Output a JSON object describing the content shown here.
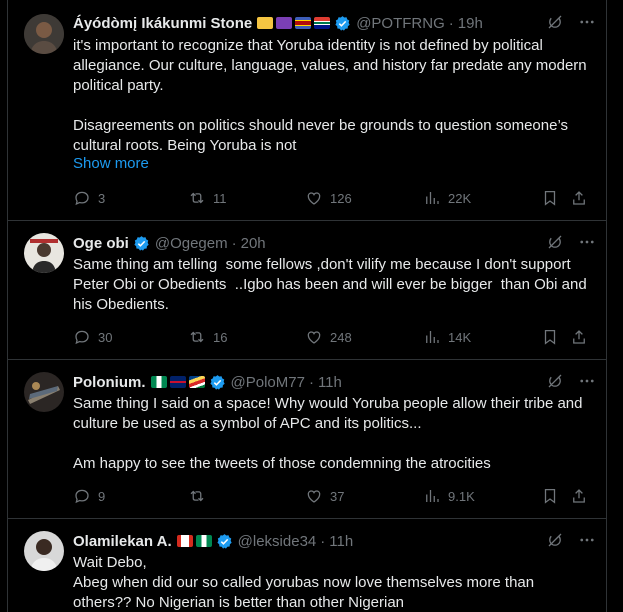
{
  "tweets": [
    {
      "name": "Áyódòmį Ikákunmi Stone",
      "handle": "@POTFRNG",
      "time": "19h",
      "text": "it's important to recognize that Yoruba identity is not defined by political allegiance. Our culture, language, values, and history far predate any modern political party.\n\nDisagreements on politics should never be grounds to question someone’s cultural roots. Being Yoruba is not",
      "show_more": "Show more",
      "replies": "3",
      "reposts": "11",
      "likes": "126",
      "views": "22K",
      "flags": [
        "person-emoji",
        "alien-emoji",
        "eswatini-flag",
        "south-africa-flag"
      ]
    },
    {
      "name": "Oge obi",
      "handle": "@Ogegem",
      "time": "20h",
      "text": "Same thing am telling  some fellows ,don't vilify me because I don't support Peter Obi or Obedients  ..Igbo has been and will ever be bigger  than Obi and his Obedients.",
      "replies": "30",
      "reposts": "16",
      "likes": "248",
      "views": "14K"
    },
    {
      "name": "Polonium.",
      "handle": "@PoloM77",
      "time": "11h",
      "text": "Same thing I said on a space! Why would Yoruba people allow their tribe and culture be used as a symbol of APC and its politics...\n\nAm happy to see the tweets of those condemning the atrocities",
      "replies": "9",
      "reposts": "",
      "likes": "37",
      "views": "9.1K",
      "flags": [
        "nigeria-flag",
        "uk-flag",
        "seychelles-flag"
      ]
    },
    {
      "name": "Olamilekan A.",
      "handle": "@lekside34",
      "time": "11h",
      "text": "Wait Debo,\nAbeg when did our so called yorubas now love themselves more than others?? No Nigerian is better than other Nigerian",
      "flags": [
        "canada-flag",
        "nigeria-flag"
      ]
    }
  ],
  "colors": {
    "background": "#000000",
    "text": "#e7e9ea",
    "muted": "#71767b",
    "accent": "#1d9bf0",
    "border": "#2f3336"
  }
}
